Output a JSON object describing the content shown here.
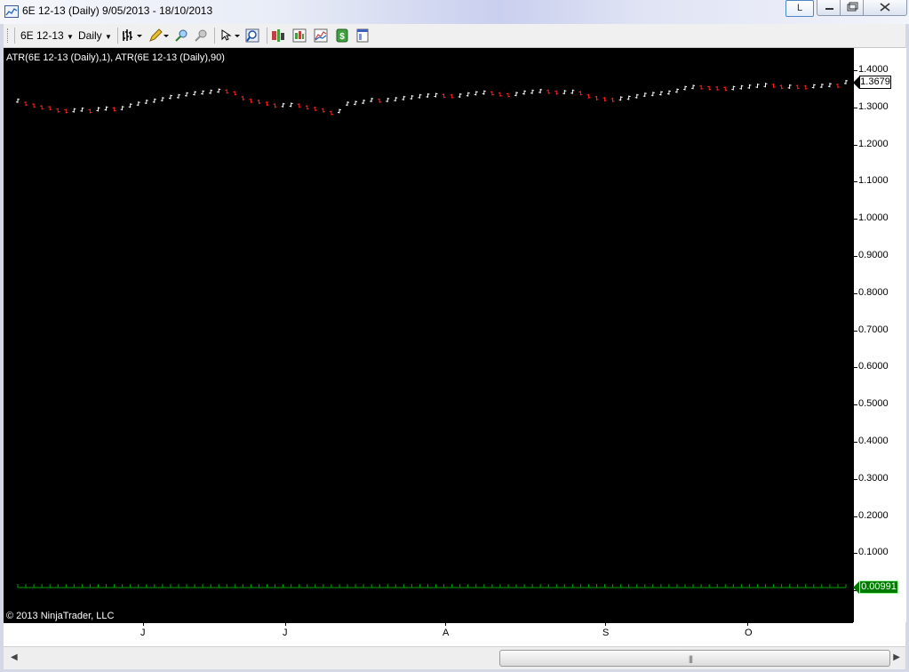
{
  "window": {
    "title": "6E 12-13 (Daily)  9/05/2013 - 18/10/2013",
    "link_button": "L"
  },
  "toolbar": {
    "instrument": "6E 12-13",
    "interval": "Daily",
    "icons": [
      "bar-type-icon",
      "drawing-pencil-icon",
      "zoom-in-icon",
      "zoom-out-icon",
      "cursor-icon",
      "magnifier-icon",
      "data-box-icon",
      "chart-style-icon",
      "indicators-icon",
      "strategies-icon",
      "properties-icon"
    ]
  },
  "chart": {
    "indicator_label": "ATR(6E 12-13 (Daily),1), ATR(6E 12-13 (Daily),90)",
    "copyright": "© 2013 NinjaTrader, LLC",
    "price_marker": "1.3679",
    "atr_marker": "0.00991",
    "y_labels": [
      "1.4000",
      "1.3000",
      "1.2000",
      "1.1000",
      "1.0000",
      "0.9000",
      "0.8000",
      "0.7000",
      "0.6000",
      "0.5000",
      "0.4000",
      "0.3000",
      "0.2000",
      "0.1000",
      "0"
    ],
    "x_labels": [
      "J",
      "J",
      "A",
      "S",
      "O"
    ],
    "colors": {
      "up_bar": "#ffffff",
      "down_bar": "#ff2020",
      "atr_line": "#00a000",
      "background": "#000000"
    }
  },
  "chart_data": {
    "type": "line",
    "ylim": [
      0,
      1.4
    ],
    "x_labels": [
      "J",
      "J",
      "A",
      "S",
      "O"
    ],
    "series": [
      {
        "values": [
          1.318,
          1.31,
          1.305,
          1.3,
          1.298,
          1.292,
          1.29,
          1.292,
          1.294,
          1.29,
          1.295,
          1.297,
          1.295,
          1.298,
          1.305,
          1.31,
          1.315,
          1.318,
          1.322,
          1.328,
          1.33,
          1.335,
          1.338,
          1.34,
          1.342,
          1.345,
          1.343,
          1.338,
          1.325,
          1.318,
          1.315,
          1.31,
          1.305,
          1.306,
          1.307,
          1.305,
          1.3,
          1.296,
          1.292,
          1.285,
          1.29,
          1.31,
          1.312,
          1.315,
          1.32,
          1.318,
          1.32,
          1.322,
          1.325,
          1.327,
          1.33,
          1.332,
          1.333,
          1.331,
          1.33,
          1.332,
          1.335,
          1.338,
          1.34,
          1.338,
          1.335,
          1.333,
          1.336,
          1.34,
          1.342,
          1.344,
          1.342,
          1.34,
          1.341,
          1.342,
          1.338,
          1.33,
          1.325,
          1.322,
          1.32,
          1.324,
          1.326,
          1.33,
          1.334,
          1.336,
          1.338,
          1.34,
          1.345,
          1.352,
          1.355,
          1.354,
          1.352,
          1.351,
          1.35,
          1.352,
          1.354,
          1.356,
          1.358,
          1.36,
          1.358,
          1.355,
          1.356,
          1.355,
          1.354,
          1.357,
          1.358,
          1.36,
          1.358,
          1.368
        ]
      },
      {
        "values": [
          0.0099,
          0.0099,
          0.0099,
          0.0099,
          0.0099,
          0.0099,
          0.0099,
          0.0099,
          0.0099,
          0.0099,
          0.0099,
          0.0099,
          0.0099,
          0.0099,
          0.0099,
          0.0099,
          0.0099,
          0.0099,
          0.0099,
          0.0099,
          0.0099,
          0.0099,
          0.0099,
          0.0099,
          0.0099,
          0.0099,
          0.0099,
          0.0099,
          0.0099,
          0.0099,
          0.0099,
          0.0099,
          0.0099,
          0.0099,
          0.0099,
          0.0099,
          0.0099,
          0.0099,
          0.0099,
          0.0099,
          0.0099,
          0.0099,
          0.0099,
          0.0099,
          0.0099,
          0.0099,
          0.0099,
          0.0099,
          0.0099,
          0.0099,
          0.0099,
          0.0099,
          0.0099,
          0.0099,
          0.0099,
          0.0099,
          0.0099,
          0.0099,
          0.0099,
          0.0099,
          0.0099,
          0.0099,
          0.0099,
          0.0099,
          0.0099,
          0.0099,
          0.0099,
          0.0099,
          0.0099,
          0.0099,
          0.0099,
          0.0099,
          0.0099,
          0.0099,
          0.0099,
          0.0099,
          0.0099,
          0.0099,
          0.0099,
          0.0099,
          0.0099,
          0.0099,
          0.0099,
          0.0099,
          0.0099,
          0.0099,
          0.0099,
          0.0099,
          0.0099,
          0.0099,
          0.0099,
          0.0099,
          0.0099,
          0.0099,
          0.0099,
          0.0099,
          0.0099,
          0.0099,
          0.0099,
          0.0099,
          0.0099,
          0.0099,
          0.0099,
          0.0099
        ]
      }
    ]
  }
}
